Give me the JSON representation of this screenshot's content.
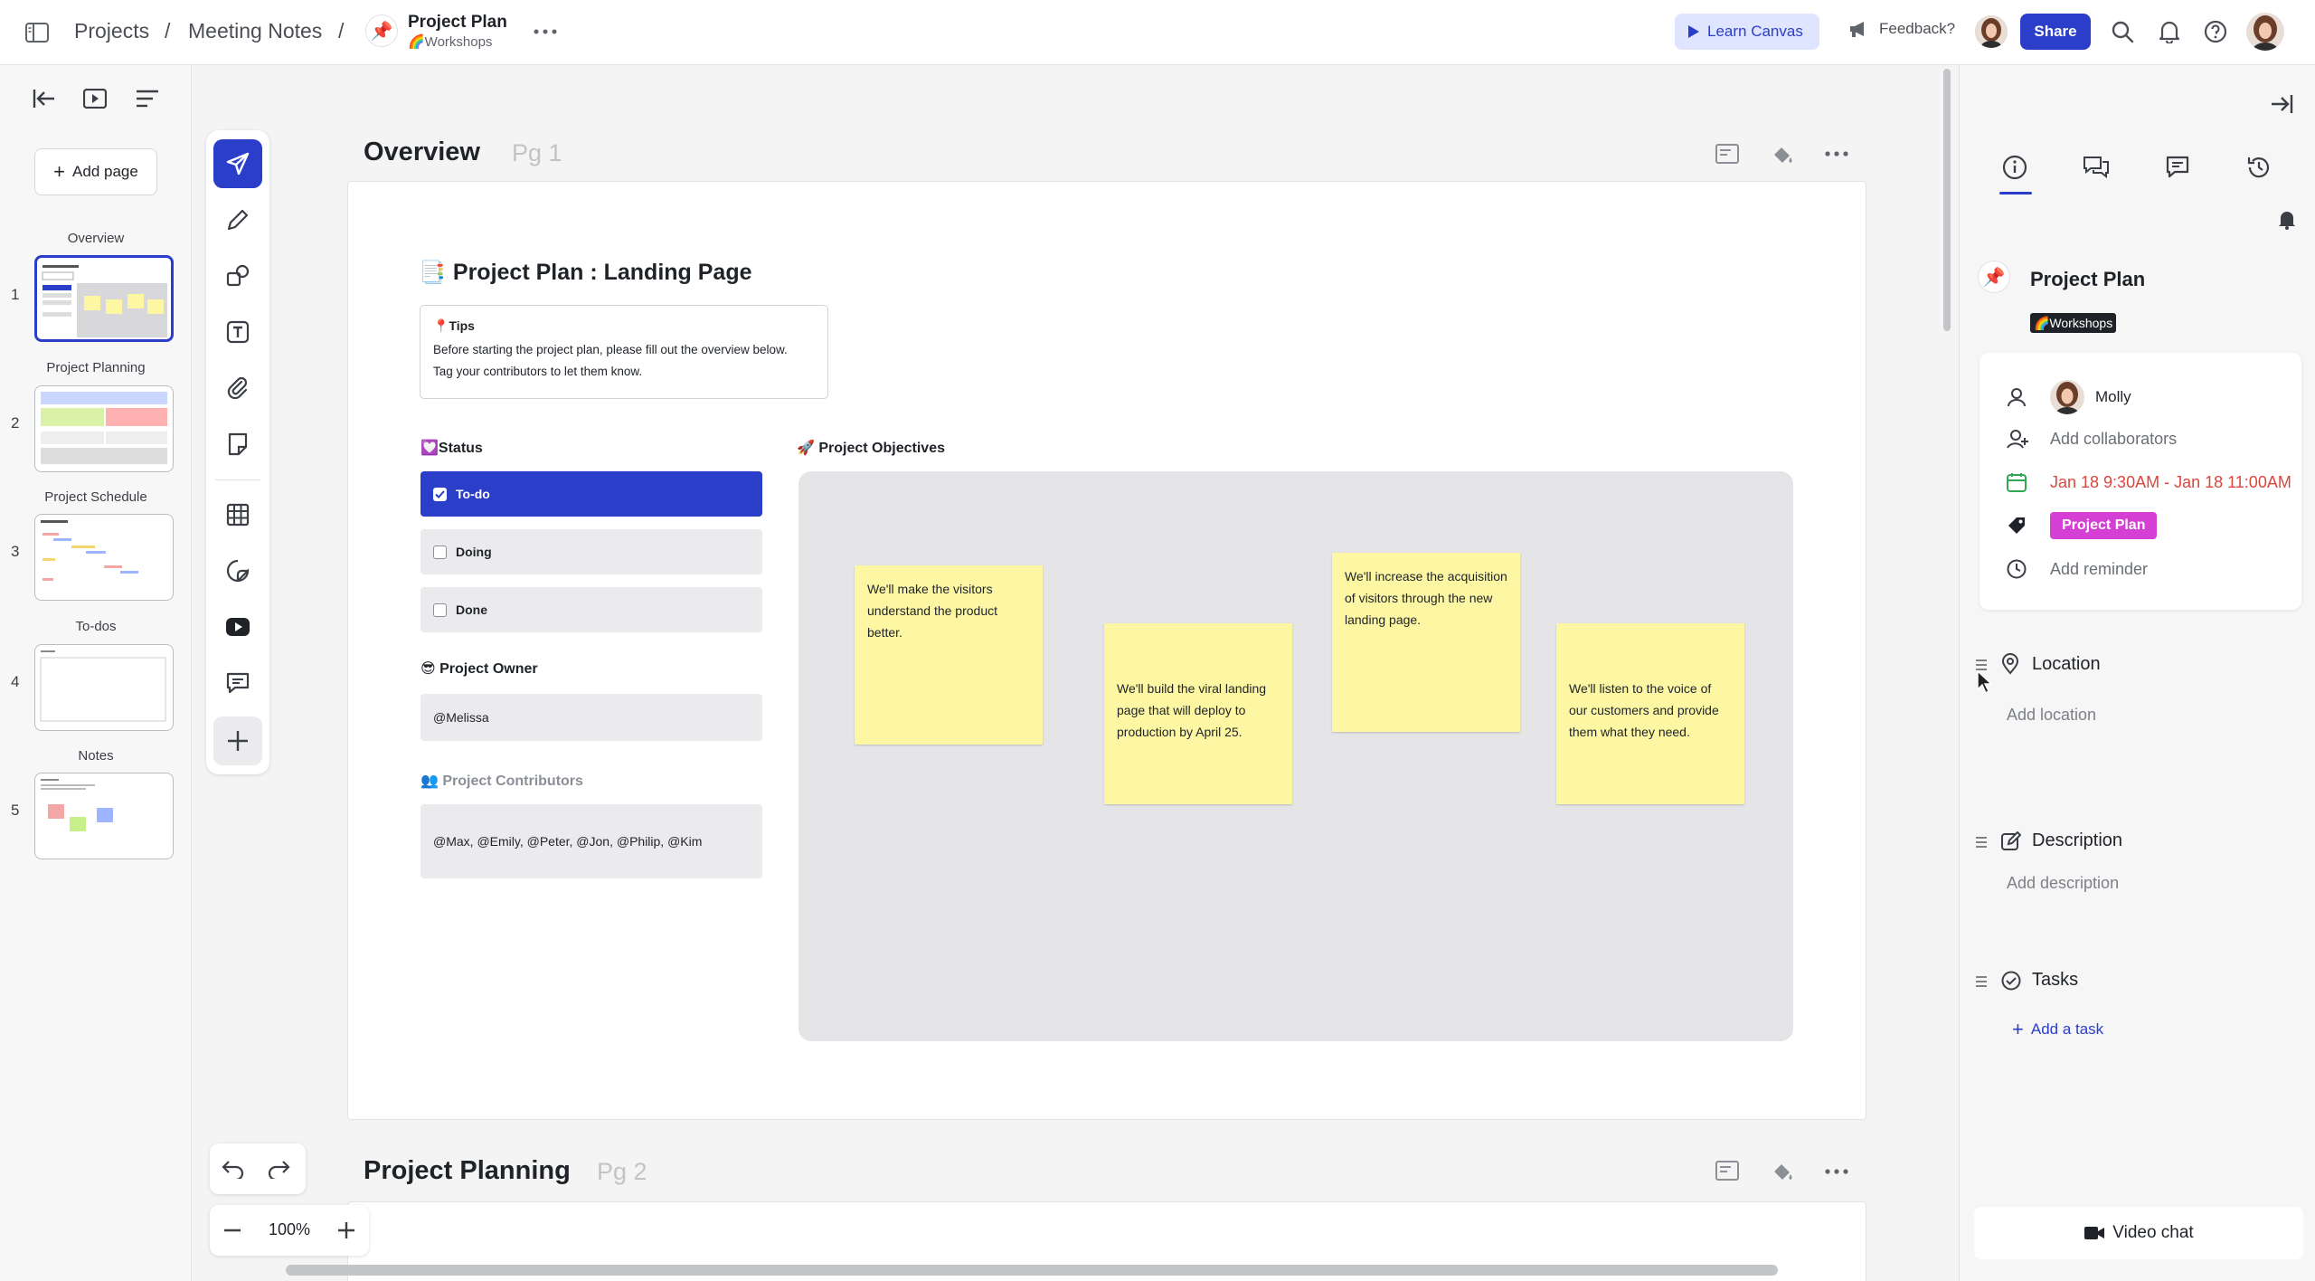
{
  "topbar": {
    "breadcrumb": [
      "Projects",
      "Meeting Notes"
    ],
    "separator": "/",
    "doc_title": "Project Plan",
    "doc_subtitle": "🌈Workshops",
    "learn_canvas": "Learn Canvas",
    "feedback": "Feedback?",
    "share": "Share",
    "accent": "#2a3ec9"
  },
  "pages_panel": {
    "add_page": "Add page",
    "pages": [
      {
        "num": "1",
        "label": "Overview"
      },
      {
        "num": "2",
        "label": "Project Planning"
      },
      {
        "num": "3",
        "label": "Project Schedule"
      },
      {
        "num": "4",
        "label": "To-dos"
      },
      {
        "num": "5",
        "label": "Notes"
      }
    ]
  },
  "tools": [
    "navigate-icon",
    "pencil-icon",
    "shapes-icon",
    "text-icon",
    "attachment-icon",
    "sticky-note-icon",
    "table-icon",
    "sticker-icon",
    "youtube-icon",
    "comment-icon",
    "plus-icon"
  ],
  "canvas": {
    "page1": {
      "title": "Overview",
      "tag": "Pg 1"
    },
    "page2": {
      "title": "Project Planning",
      "tag": "Pg 2"
    },
    "doc": {
      "heading": "Project Plan : Landing Page",
      "tips_title": "📍Tips",
      "tips_line1": "Before starting the project plan, please fill out the overview below.",
      "tips_line2": "Tag your contributors to let them know.",
      "status_title": "💟Status",
      "status_options": [
        {
          "label": "To-do",
          "checked": true
        },
        {
          "label": "Doing",
          "checked": false
        },
        {
          "label": "Done",
          "checked": false
        }
      ],
      "owner_title": "😎 Project Owner",
      "owner_value": "@Melissa",
      "contributors_title": "👥 Project Contributors",
      "contributors_value": "@Max, @Emily, @Peter, @Jon, @Philip, @Kim",
      "objectives_title": "🚀 Project Objectives",
      "stickies": [
        "We'll make the visitors understand the product better.",
        "We'll build the viral landing page that will deploy to production by April 25.",
        "We'll increase the acquisition of visitors through the new landing page.",
        "We'll listen to the voice of our customers and provide them what they need."
      ]
    },
    "zoom": "100%"
  },
  "right_panel": {
    "title": "Project Plan",
    "badge": "🌈Workshops",
    "owner": "Molly",
    "add_collaborators": "Add collaborators",
    "date_range": "Jan 18 9:30AM - Jan 18 11:00AM",
    "tag": "Project Plan",
    "add_reminder": "Add reminder",
    "location_title": "Location",
    "add_location": "Add location",
    "description_title": "Description",
    "add_description": "Add description",
    "tasks_title": "Tasks",
    "add_task": "Add a task",
    "video_chat": "Video chat",
    "date_color": "#d9473f",
    "tag_color": "#d63fd3"
  }
}
